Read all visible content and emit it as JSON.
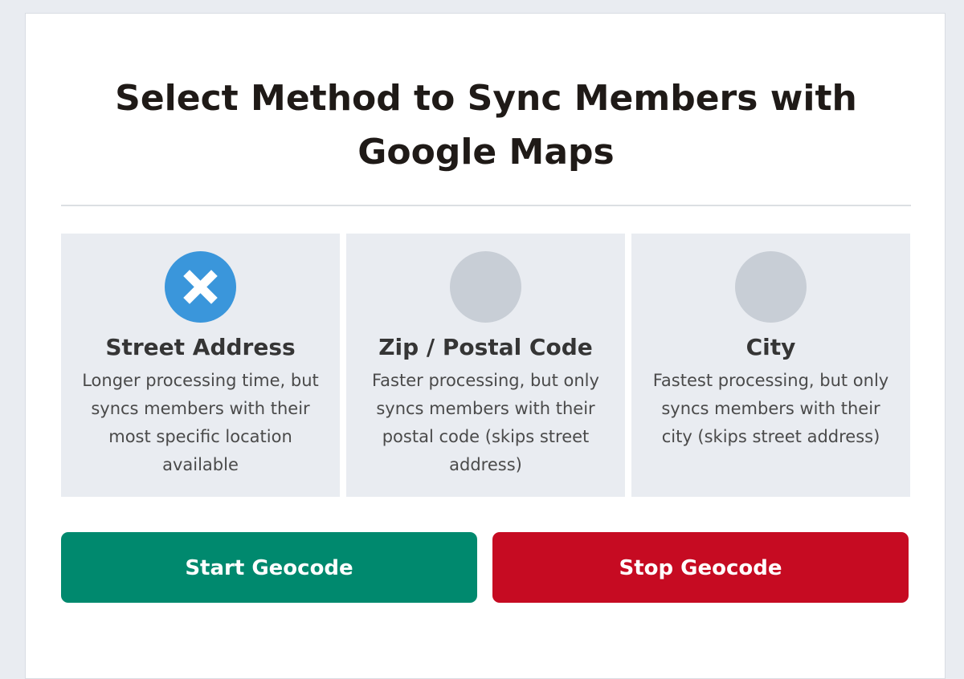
{
  "page": {
    "title": "Select Method to Sync Members with Google Maps"
  },
  "options": [
    {
      "label": "Street Address",
      "description": "Longer processing time, but syncs members with their most specific location available",
      "selected": true,
      "icon": "close-x-icon"
    },
    {
      "label": "Zip / Postal Code",
      "description": "Faster processing, but only syncs members with their postal code (skips street address)",
      "selected": false,
      "icon": ""
    },
    {
      "label": "City",
      "description": "Fastest processing, but only syncs members with their city (skips street address)",
      "selected": false,
      "icon": ""
    }
  ],
  "actions": {
    "start_label": "Start Geocode",
    "stop_label": "Stop Geocode"
  },
  "colors": {
    "background": "#e9ecf1",
    "selected_accent": "#3a96db",
    "unselected_radio": "#c8ced6",
    "start_button": "#00896e",
    "stop_button": "#c60b22"
  }
}
